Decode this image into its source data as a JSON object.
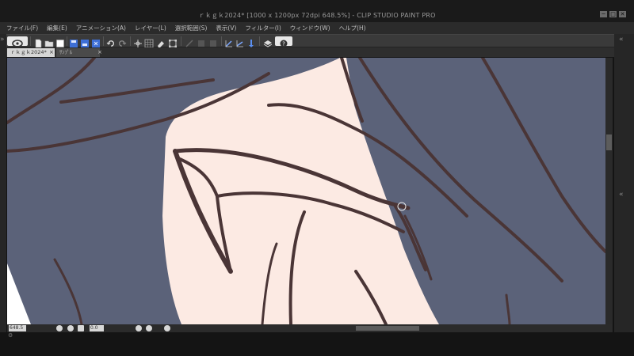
{
  "window": {
    "title": "ｒｋｇｋ2024* [1000 x 1200px 72dpi 648.5%] - CLIP STUDIO PAINT PRO",
    "controls": [
      "─",
      "□",
      "✕"
    ]
  },
  "menu": [
    "ファイル(F)",
    "編集(E)",
    "アニメーション(A)",
    "レイヤー(L)",
    "選択範囲(S)",
    "表示(V)",
    "フィルター(I)",
    "ウィンドウ(W)",
    "ヘルプ(H)"
  ],
  "toolbar": {
    "icons": [
      "clip-studio-icon",
      "new-file-icon",
      "open-file-icon",
      "save-icon",
      "save-as-icon",
      "export-icon",
      "undo-icon",
      "redo-icon",
      "transform-icon",
      "grid-icon",
      "clear-icon",
      "free-transform-icon",
      "ruler-icon",
      "snap-icon",
      "align-icon",
      "layer-icon",
      "help-icon"
    ]
  },
  "tabs": [
    {
      "label": "ｒｋｇｋ2024*"
    },
    {
      "label": "ｻﾝﾌﾟﾙ"
    }
  ],
  "status": {
    "zoom": "648.5",
    "angle": "0.0"
  },
  "colors": {
    "canvas_bg": "#5b6279",
    "skin": "#fceae3",
    "line": "#4a3536",
    "white": "#ffffff"
  }
}
